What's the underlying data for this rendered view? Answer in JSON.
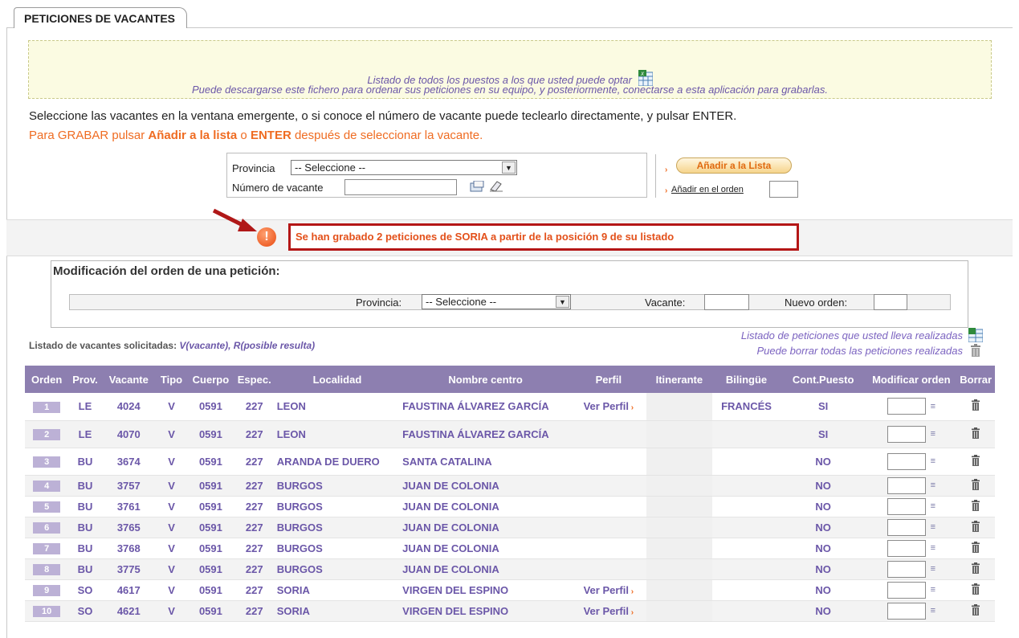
{
  "tab": {
    "title": "PETICIONES DE VACANTES"
  },
  "info": {
    "line1": "Listado de todos los puestos a los que usted puede optar",
    "line2": "Puede descargarse este fichero para ordenar sus peticiones en su equipo, y posteriormente, conectarse a esta aplicación para grabarlas."
  },
  "instructions": {
    "line1": "Seleccione las vacantes en la ventana emergente, o si conoce el número de vacante puede teclearlo directamente, y pulsar ENTER.",
    "line2_a": "Para GRABAR pulsar ",
    "line2_b": "Añadir a la lista",
    "line2_c": " o ",
    "line2_d": "ENTER",
    "line2_e": " después de seleccionar la vacante."
  },
  "form": {
    "provincia_label": "Provincia",
    "provincia_value": "-- Seleccione --",
    "vacante_label": "Número de vacante",
    "add_button": "Añadir a la Lista",
    "add_order_label": "Añadir en el orden"
  },
  "alert": {
    "message": "Se han grabado 2 peticiones de SORIA a partir de la posición 9 de su listado"
  },
  "modify": {
    "title": "Modificación del orden de una petición:",
    "provincia_label": "Provincia:",
    "provincia_value": "-- Seleccione --",
    "vacante_label": "Vacante:",
    "nuevo_orden_label": "Nuevo orden:"
  },
  "list": {
    "title": "Listado de vacantes solicitadas:",
    "legend": "V(vacante), R(posible resulta)",
    "link1": "Listado de peticiones que usted lleva realizadas",
    "link2": "Puede borrar todas las peticiones realizadas"
  },
  "table": {
    "headers": [
      "Orden",
      "Prov.",
      "Vacante",
      "Tipo",
      "Cuerpo",
      "Espec.",
      "Localidad",
      "Nombre centro",
      "Perfil",
      "Itinerante",
      "Bilingüe",
      "Cont.Puesto",
      "Modificar orden",
      "Borrar"
    ],
    "rows": [
      [
        "1",
        "LE",
        "4024",
        "V",
        "0591",
        "227",
        "LEON",
        "FAUSTINA ÁLVAREZ GARCÍA",
        "Ver Perfil",
        "",
        "FRANCÉS",
        "SI"
      ],
      [
        "2",
        "LE",
        "4070",
        "V",
        "0591",
        "227",
        "LEON",
        "FAUSTINA ÁLVAREZ GARCÍA",
        "",
        "",
        "",
        "SI"
      ],
      [
        "3",
        "BU",
        "3674",
        "V",
        "0591",
        "227",
        "ARANDA DE DUERO",
        "SANTA CATALINA",
        "",
        "",
        "",
        "NO"
      ],
      [
        "4",
        "BU",
        "3757",
        "V",
        "0591",
        "227",
        "BURGOS",
        "JUAN DE COLONIA",
        "",
        "",
        "",
        "NO"
      ],
      [
        "5",
        "BU",
        "3761",
        "V",
        "0591",
        "227",
        "BURGOS",
        "JUAN DE COLONIA",
        "",
        "",
        "",
        "NO"
      ],
      [
        "6",
        "BU",
        "3765",
        "V",
        "0591",
        "227",
        "BURGOS",
        "JUAN DE COLONIA",
        "",
        "",
        "",
        "NO"
      ],
      [
        "7",
        "BU",
        "3768",
        "V",
        "0591",
        "227",
        "BURGOS",
        "JUAN DE COLONIA",
        "",
        "",
        "",
        "NO"
      ],
      [
        "8",
        "BU",
        "3775",
        "V",
        "0591",
        "227",
        "BURGOS",
        "JUAN DE COLONIA",
        "",
        "",
        "",
        "NO"
      ],
      [
        "9",
        "SO",
        "4617",
        "V",
        "0591",
        "227",
        "SORIA",
        "VIRGEN DEL ESPINO",
        "Ver Perfil",
        "",
        "",
        "NO"
      ],
      [
        "10",
        "SO",
        "4621",
        "V",
        "0591",
        "227",
        "SORIA",
        "VIRGEN DEL ESPINO",
        "Ver Perfil",
        "",
        "",
        "NO"
      ]
    ]
  }
}
